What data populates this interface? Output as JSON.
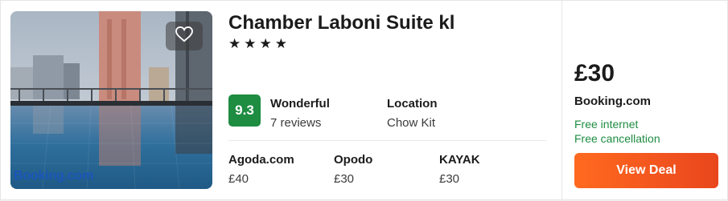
{
  "hotel": {
    "name": "Chamber Laboni Suite kl",
    "stars_display": "★★★★",
    "star_count": 4,
    "photo_watermark": "Booking.com"
  },
  "rating": {
    "score": "9.3",
    "label": "Wonderful",
    "reviews": "7 reviews"
  },
  "location": {
    "label": "Location",
    "value": "Chow Kit"
  },
  "providers": [
    {
      "name": "Agoda.com",
      "price": "£40"
    },
    {
      "name": "Opodo",
      "price": "£30"
    },
    {
      "name": "KAYAK",
      "price": "£30"
    }
  ],
  "deal": {
    "price": "£30",
    "site": "Booking.com",
    "features": [
      "Free internet",
      "Free cancellation"
    ],
    "button_label": "View Deal"
  },
  "colors": {
    "score_badge": "#1e8c41",
    "feature_text": "#1e8c41",
    "button_start": "#ff6a1f",
    "button_end": "#e9461d",
    "watermark": "#1a56b8"
  },
  "icons": {
    "favorite": "heart-icon"
  }
}
